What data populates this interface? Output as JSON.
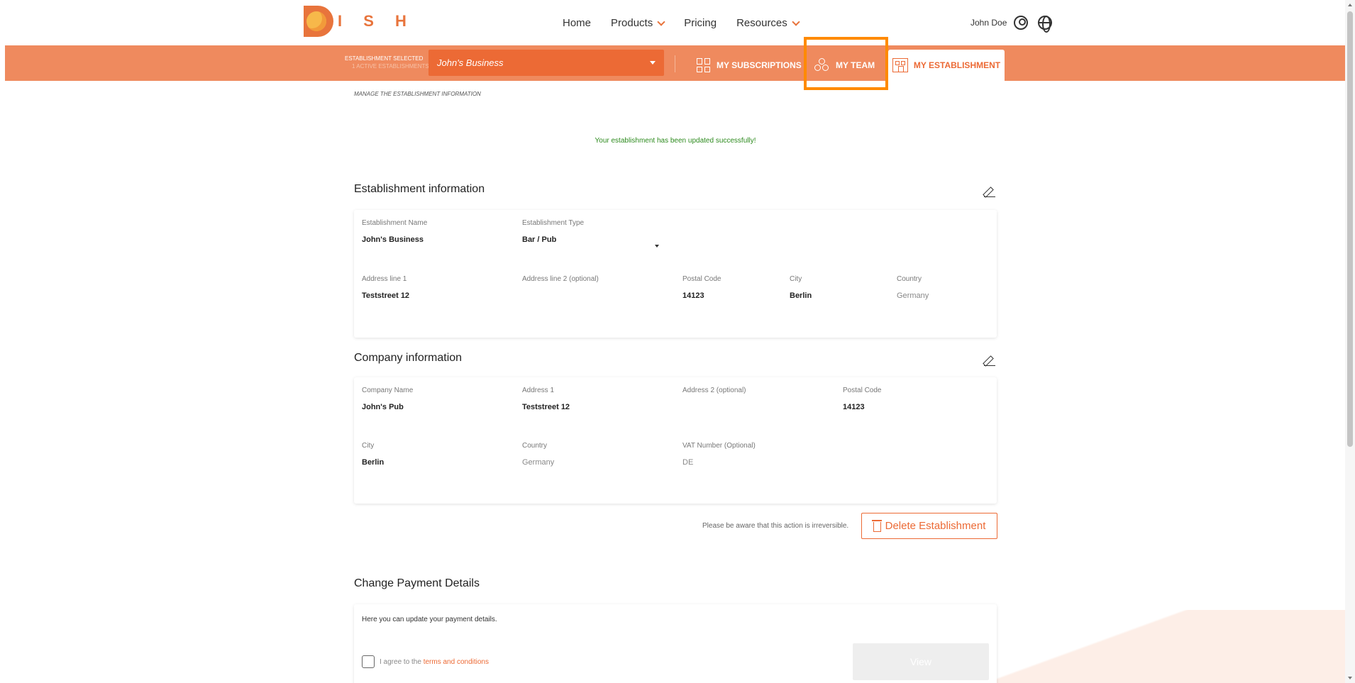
{
  "header": {
    "brand": "I S H",
    "nav": [
      {
        "label": "Home"
      },
      {
        "label": "Products"
      },
      {
        "label": "Pricing"
      },
      {
        "label": "Resources"
      }
    ],
    "user_name": "John Doe"
  },
  "establishment_bar": {
    "label": "ESTABLISHMENT SELECTED",
    "sublabel": "1 ACTIVE ESTABLISHMENTS",
    "selected": "John's Business",
    "tabs": {
      "subscriptions": "MY SUBSCRIPTIONS",
      "team": "MY TEAM",
      "establishment": "MY ESTABLISHMENT"
    }
  },
  "page": {
    "breadcrumb": "MANAGE THE ESTABLISHMENT INFORMATION",
    "success_message": "Your establishment has been updated successfully!"
  },
  "establishment_info": {
    "title": "Establishment information",
    "name_label": "Establishment Name",
    "name_value": "John's Business",
    "type_label": "Establishment Type",
    "type_value": "Bar / Pub",
    "address1_label": "Address line 1",
    "address1_value": "Teststreet 12",
    "address2_label": "Address line 2 (optional)",
    "postal_label": "Postal Code",
    "postal_value": "14123",
    "city_label": "City",
    "city_value": "Berlin",
    "country_label": "Country",
    "country_value": "Germany"
  },
  "company_info": {
    "title": "Company information",
    "name_label": "Company Name",
    "name_value": "John's Pub",
    "address1_label": "Address 1",
    "address1_value": "Teststreet 12",
    "address2_label": "Address 2 (optional)",
    "postal_label": "Postal Code",
    "postal_value": "14123",
    "city_label": "City",
    "city_value": "Berlin",
    "country_label": "Country",
    "country_value": "Germany",
    "vat_label": "VAT Number (Optional)",
    "vat_value": "DE"
  },
  "delete": {
    "note": "Please be aware that this action is irreversible.",
    "button": "Delete Establishment"
  },
  "payment": {
    "title": "Change Payment Details",
    "description": "Here you can update your payment details.",
    "agree_prefix": "I agree to the",
    "terms_link": "terms and conditions",
    "view_button": "View"
  },
  "colors": {
    "accent": "#ec6a35",
    "bar": "#ef8a5e",
    "highlight": "#ff8a00",
    "success": "#2e8b1f"
  }
}
